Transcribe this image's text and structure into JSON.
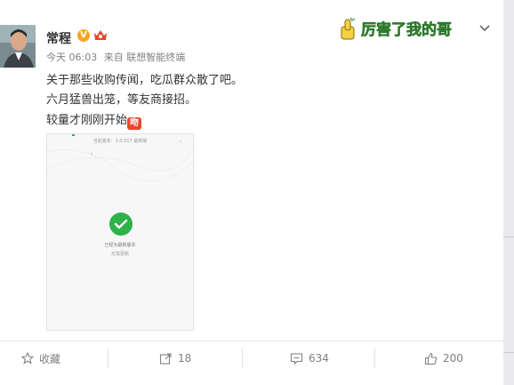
{
  "post": {
    "username": "常程",
    "verified_badge": "V",
    "timestamp": "今天 06:03",
    "source_prefix": "来自",
    "source": "联想智能终端",
    "text_lines": [
      "关于那些收购传闻，吃瓜群众散了吧。",
      "六月猛兽出笼，等友商接招。",
      "较量才刚刚开始"
    ],
    "inline_emoji_text": "吻",
    "sticker_text": "厉害了我的哥",
    "image": {
      "version_text": "当前版本：3.0.017 最新版",
      "caption_line1": "已经为最新版本",
      "caption_line2": "无需更新"
    }
  },
  "actions": {
    "collect_label": "收藏",
    "repost_count": "18",
    "comment_count": "634",
    "like_count": "200"
  },
  "colors": {
    "accent_orange": "#f6a623",
    "check_green": "#2eb24a",
    "emoji_red": "#e8472b"
  },
  "icons": {
    "more": "chevron-down-icon",
    "collect": "star-icon",
    "repost": "repost-icon",
    "comment": "comment-icon",
    "like": "thumbs-up-icon"
  }
}
